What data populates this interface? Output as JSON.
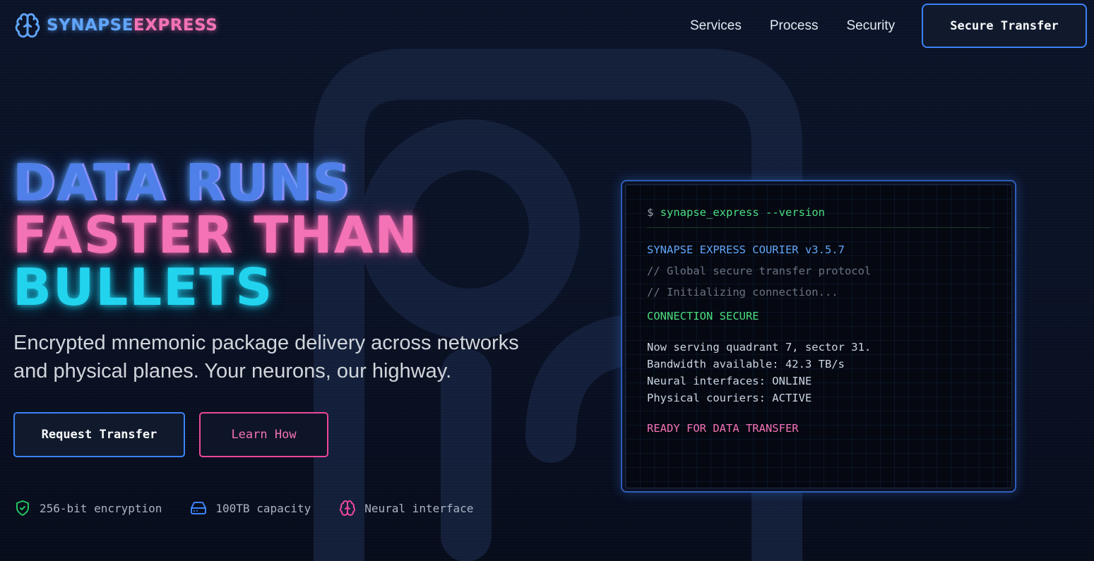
{
  "brand": {
    "part1": "SYNAPSE",
    "part2": "EXPRESS",
    "icon": "brain-icon"
  },
  "nav": {
    "items": [
      {
        "label": "Services"
      },
      {
        "label": "Process"
      },
      {
        "label": "Security"
      }
    ],
    "cta_label": "Secure Transfer"
  },
  "hero": {
    "title_line1": "DATA RUNS",
    "title_line2": "FASTER THAN",
    "title_line3": "BULLETS",
    "subtitle": "Encrypted mnemonic package delivery across networks and physical planes. Your neurons, our highway.",
    "primary_button": "Request Transfer",
    "secondary_button": "Learn How"
  },
  "features": [
    {
      "icon": "shield-check-icon",
      "label": "256-bit encryption",
      "color": "#22c55e"
    },
    {
      "icon": "hard-drive-icon",
      "label": "100TB capacity",
      "color": "#3b82f6"
    },
    {
      "icon": "brain-icon",
      "label": "Neural interface",
      "color": "#ec4899"
    }
  ],
  "terminal": {
    "prompt": "$",
    "command": "synapse_express --version",
    "version_line": "SYNAPSE EXPRESS COURIER v3.5.7",
    "comment1": "// Global secure transfer protocol",
    "comment2": "// Initializing connection...",
    "status": "CONNECTION SECURE",
    "info": [
      "Now serving quadrant 7, sector 31.",
      "Bandwidth available: 42.3 TB/s",
      "Neural interfaces: ONLINE",
      "Physical couriers: ACTIVE"
    ],
    "ready": "READY FOR DATA TRANSFER"
  },
  "colors": {
    "accent_blue": "#3b82f6",
    "accent_pink": "#ec4899",
    "accent_cyan": "#22d3ee",
    "terminal_green": "#4ade80"
  }
}
